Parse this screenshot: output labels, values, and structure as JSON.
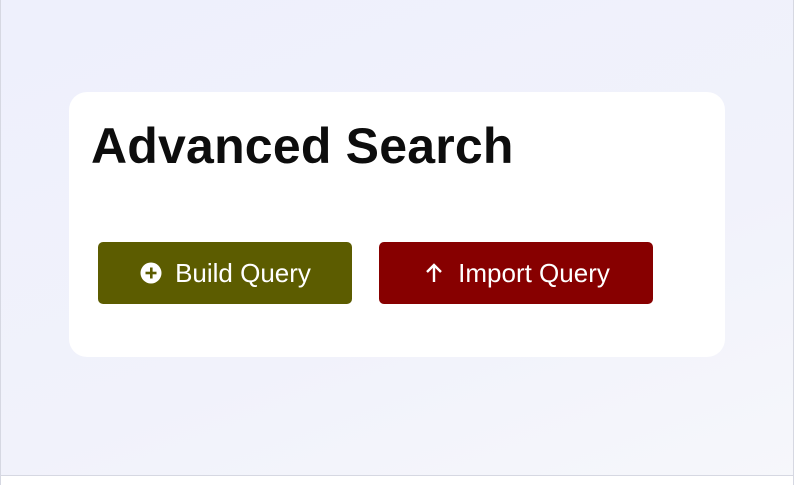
{
  "page": {
    "title": "Advanced Search"
  },
  "actions": {
    "build": {
      "label": "Build Query",
      "icon": "plus-circle-icon",
      "color": "#5c5c00"
    },
    "import": {
      "label": "Import Query",
      "icon": "arrow-up-icon",
      "color": "#870000"
    }
  }
}
